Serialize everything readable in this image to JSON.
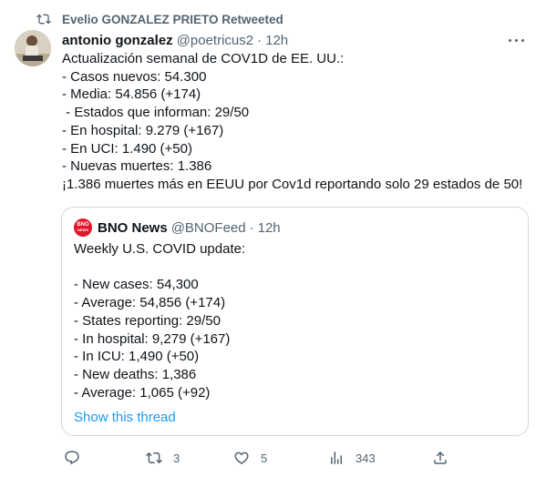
{
  "retweet_header": {
    "text": "Evelio GONZALEZ PRIETO Retweeted"
  },
  "tweet": {
    "author_name": "antonio gonzalez",
    "author_handle": "@poetricus2",
    "separator": "·",
    "time": "12h",
    "lines": [
      "Actualización semanal de COV1D de EE. UU.:",
      "- Casos nuevos: 54.300",
      "- Media: 54.856 (+174)",
      " - Estados que informan: 29/50",
      "- En hospital: 9.279 (+167)",
      "- En UCI: 1.490 (+50)",
      "- Nuevas muertes: 1.386",
      "¡1.386 muertes más en EEUU por Cov1d reportando solo 29 estados de 50!"
    ]
  },
  "quoted_tweet": {
    "avatar_text": [
      "BNO",
      "NEWS"
    ],
    "author_name": "BNO News",
    "author_handle": "@BNOFeed",
    "separator": "·",
    "time": "12h",
    "lines": [
      "Weekly U.S. COVID update:",
      "",
      "- New cases: 54,300",
      "- Average: 54,856 (+174)",
      "- States reporting: 29/50",
      "- In hospital: 9,279 (+167)",
      "- In ICU: 1,490 (+50)",
      "- New deaths: 1,386",
      "- Average: 1,065 (+92)"
    ],
    "show_thread": "Show this thread"
  },
  "actions": {
    "reply_count": "",
    "retweet_count": "3",
    "like_count": "5",
    "views_count": "343"
  },
  "colors": {
    "link": "#1d9bf0",
    "secondary_text": "#536471",
    "bno_red": "#e3152a"
  }
}
